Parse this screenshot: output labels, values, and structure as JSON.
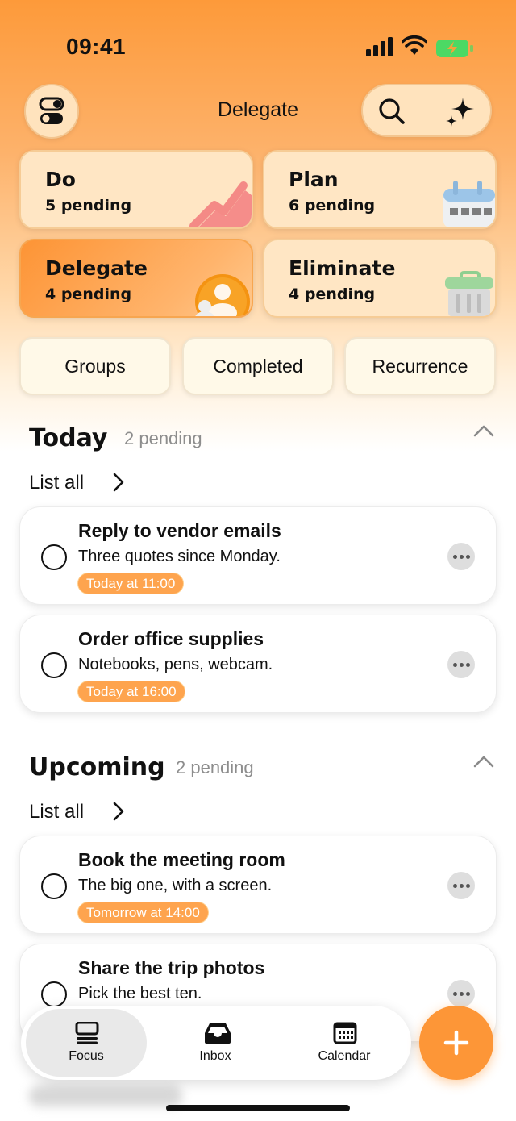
{
  "status_bar": {
    "time": "09:41"
  },
  "header": {
    "title": "Delegate"
  },
  "quadrants": [
    {
      "title": "Do",
      "subtitle": "5 pending"
    },
    {
      "title": "Plan",
      "subtitle": "6 pending"
    },
    {
      "title": "Delegate",
      "subtitle": "4 pending"
    },
    {
      "title": "Eliminate",
      "subtitle": "4 pending"
    }
  ],
  "chips": [
    "Groups",
    "Completed",
    "Recurrence"
  ],
  "sections": [
    {
      "title": "Today",
      "count": "2 pending",
      "list_all": "List all",
      "tasks": [
        {
          "title": "Reply to vendor emails",
          "desc": "Three quotes since Monday.",
          "due": "Today at 11:00"
        },
        {
          "title": "Order office supplies",
          "desc": "Notebooks, pens, webcam.",
          "due": "Today at 16:00"
        }
      ]
    },
    {
      "title": "Upcoming",
      "count": "2 pending",
      "list_all": "List all",
      "tasks": [
        {
          "title": "Book the meeting room",
          "desc": "The big one, with a screen.",
          "due": "Tomorrow at 14:00"
        },
        {
          "title": "Share the trip photos",
          "desc": "Pick the best ten."
        }
      ]
    }
  ],
  "tabbar": {
    "tabs": [
      "Focus",
      "Inbox",
      "Calendar"
    ],
    "active": "Focus"
  },
  "colors": {
    "accent": "#fd9637",
    "due_badge": "#fea44e"
  }
}
